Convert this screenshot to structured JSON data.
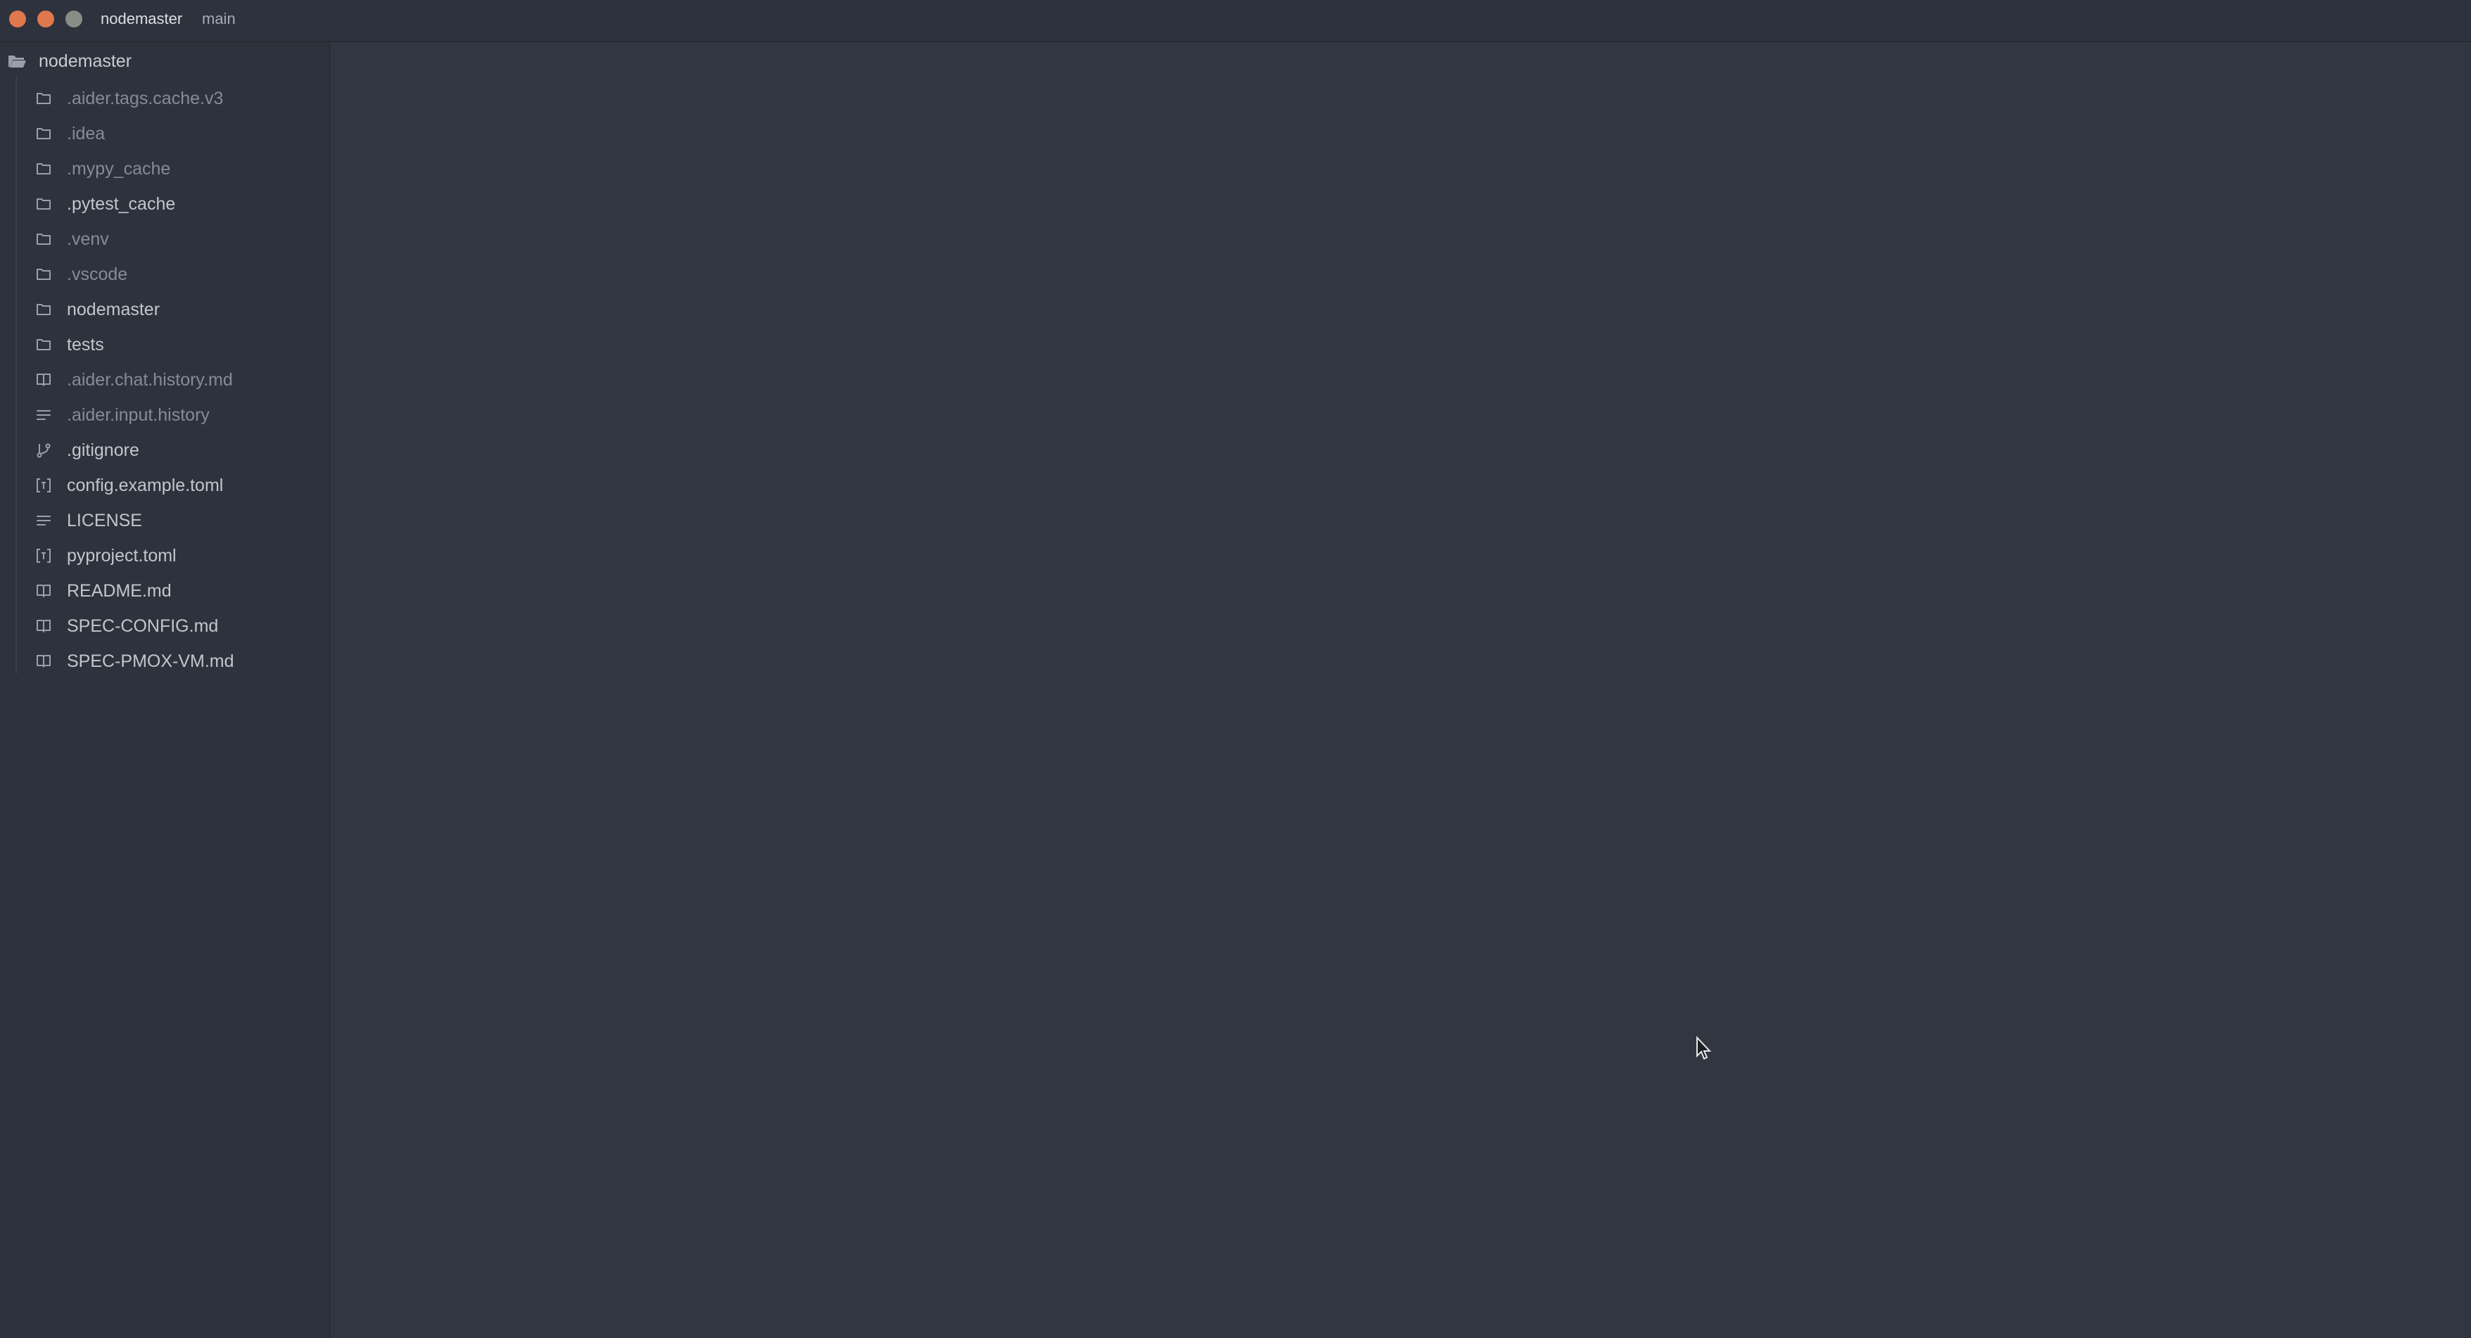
{
  "titlebar": {
    "project": "nodemaster",
    "branch": "main"
  },
  "sidebar": {
    "root": {
      "label": "nodemaster",
      "icon": "folder-open-icon"
    },
    "items": [
      {
        "label": ".aider.tags.cache.v3",
        "icon": "folder-icon",
        "dim": true
      },
      {
        "label": ".idea",
        "icon": "folder-icon",
        "dim": true
      },
      {
        "label": ".mypy_cache",
        "icon": "folder-icon",
        "dim": true
      },
      {
        "label": ".pytest_cache",
        "icon": "folder-icon",
        "dim": false
      },
      {
        "label": ".venv",
        "icon": "folder-icon",
        "dim": true
      },
      {
        "label": ".vscode",
        "icon": "folder-icon",
        "dim": true
      },
      {
        "label": "nodemaster",
        "icon": "folder-icon",
        "dim": false
      },
      {
        "label": "tests",
        "icon": "folder-icon",
        "dim": false
      },
      {
        "label": ".aider.chat.history.md",
        "icon": "book-icon",
        "dim": true
      },
      {
        "label": ".aider.input.history",
        "icon": "text-lines-icon",
        "dim": true
      },
      {
        "label": ".gitignore",
        "icon": "git-icon",
        "dim": false
      },
      {
        "label": "config.example.toml",
        "icon": "toml-icon",
        "dim": false
      },
      {
        "label": "LICENSE",
        "icon": "text-lines-icon",
        "dim": false
      },
      {
        "label": "pyproject.toml",
        "icon": "toml-icon",
        "dim": false
      },
      {
        "label": "README.md",
        "icon": "book-icon",
        "dim": false
      },
      {
        "label": "SPEC-CONFIG.md",
        "icon": "book-icon",
        "dim": false
      },
      {
        "label": "SPEC-PMOX-VM.md",
        "icon": "book-icon",
        "dim": false
      }
    ]
  },
  "colors": {
    "background": "#323641",
    "sidebar": "#2e323c",
    "text": "#c3c6cc",
    "text_dim": "#878b95",
    "close": "#e0784e",
    "maximize": "#8a8d86"
  }
}
